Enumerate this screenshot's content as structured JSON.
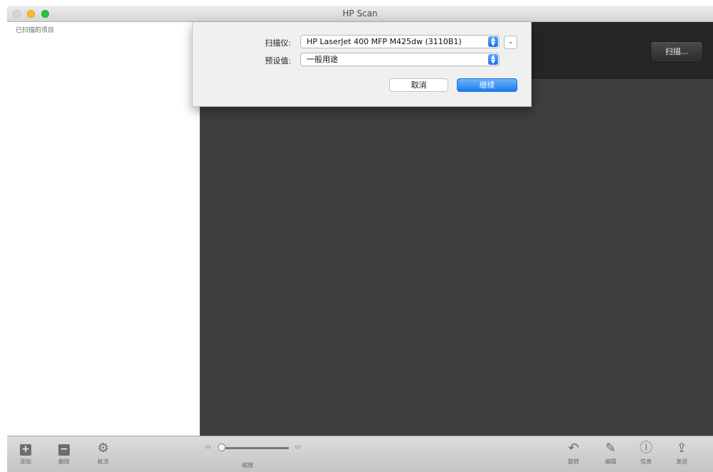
{
  "window": {
    "title": "HP Scan"
  },
  "sidebar": {
    "title": "已扫描的项目"
  },
  "preview": {
    "scan_button": "扫描..."
  },
  "dialog": {
    "scanner_label": "扫描仪:",
    "scanner_value": "HP LaserJet 400 MFP M425dw (3110B1)",
    "preset_label": "预设值:",
    "preset_value": "一般用途",
    "cancel_label": "取消",
    "continue_label": "继续"
  },
  "toolbar": {
    "add_label": "添加",
    "delete_label": "删除",
    "batch_label": "批次",
    "zoom_label": "缩放",
    "rotate_label": "旋转",
    "edit_label": "编辑",
    "info_label": "信息",
    "send_label": "发送"
  },
  "colors": {
    "accent": "#1c7cf0",
    "preview_bg": "#3e3e3e",
    "preview_header": "#262626"
  }
}
